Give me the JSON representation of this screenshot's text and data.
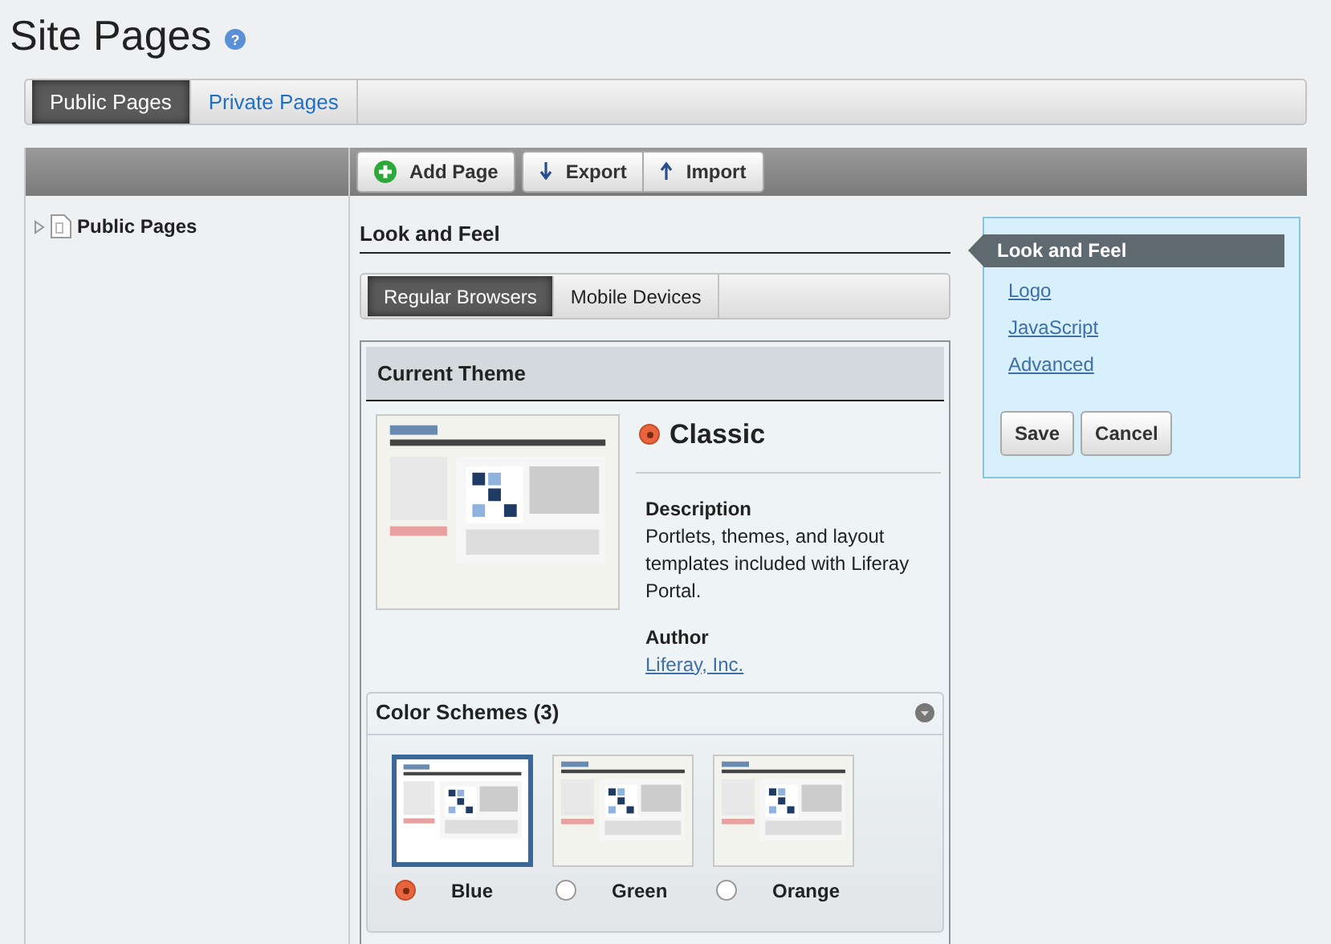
{
  "page_title": "Site Pages",
  "help_glyph": "?",
  "tabs": [
    {
      "label": "Public Pages",
      "selected": true
    },
    {
      "label": "Private Pages",
      "selected": false
    }
  ],
  "toolbar": [
    {
      "label": "Add Page",
      "kind": "add"
    },
    {
      "label": "Export",
      "kind": "export"
    },
    {
      "label": "Import",
      "kind": "import"
    }
  ],
  "tree": [
    {
      "label": "Public Pages",
      "expanded": false
    }
  ],
  "section_title": "Look and Feel",
  "device_tabs": [
    {
      "label": "Regular Browsers",
      "selected": true
    },
    {
      "label": "Mobile Devices",
      "selected": false
    }
  ],
  "current_theme": {
    "heading": "Current Theme",
    "name": "Classic",
    "selected": true,
    "description_label": "Description",
    "description": "Portlets, themes, and layout templates included with Liferay Portal.",
    "author_label": "Author",
    "author": "Liferay, Inc."
  },
  "color_schemes": {
    "heading": "Color Schemes (3)",
    "items": [
      {
        "label": "Blue",
        "selected": true
      },
      {
        "label": "Green",
        "selected": false
      },
      {
        "label": "Orange",
        "selected": false
      }
    ]
  },
  "side_nav": [
    {
      "label": "Look and Feel",
      "selected": true
    },
    {
      "label": "Logo",
      "selected": false
    },
    {
      "label": "JavaScript",
      "selected": false
    },
    {
      "label": "Advanced",
      "selected": false
    }
  ],
  "side_buttons": [
    "Save",
    "Cancel"
  ]
}
